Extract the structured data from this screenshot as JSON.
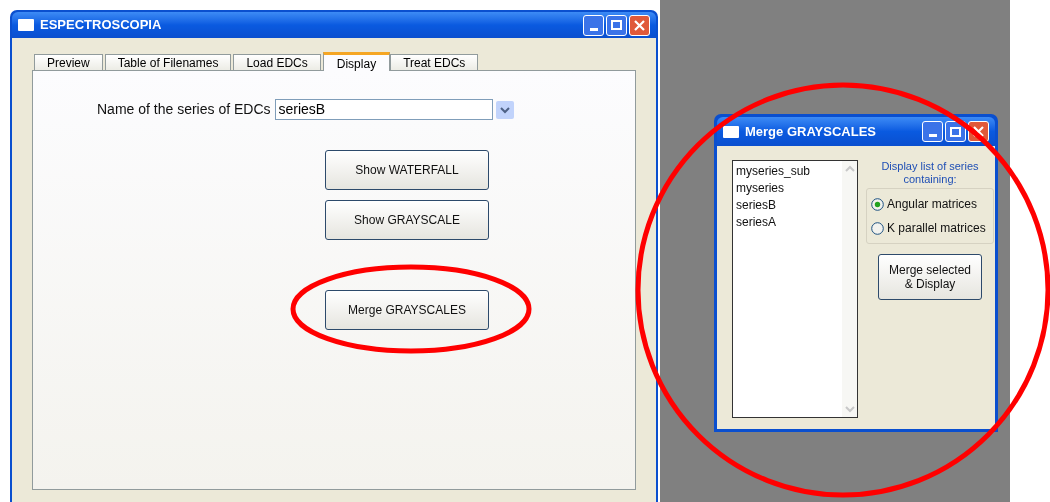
{
  "main_window": {
    "title": "ESPECTROSCOPIA",
    "tabs": [
      {
        "label": "Preview",
        "selected": false
      },
      {
        "label": "Table of Filenames",
        "selected": false
      },
      {
        "label": "Load EDCs",
        "selected": false
      },
      {
        "label": "Display",
        "selected": true
      },
      {
        "label": "Treat EDCs",
        "selected": false
      }
    ],
    "series_label": "Name of the series of EDCs",
    "series_value": "seriesB",
    "buttons": [
      "Show WATERFALL",
      "Show GRAYSCALE",
      "Merge GRAYSCALES"
    ]
  },
  "dialog": {
    "title": "Merge GRAYSCALES",
    "series_list": [
      "myseries_sub",
      "myseries",
      "seriesB",
      "seriesA"
    ],
    "group_label": "Display list of series containing:",
    "options": [
      {
        "label": "Angular matrices",
        "selected": true
      },
      {
        "label": "K parallel matrices",
        "selected": false
      }
    ],
    "button": "Merge selected & Display"
  }
}
